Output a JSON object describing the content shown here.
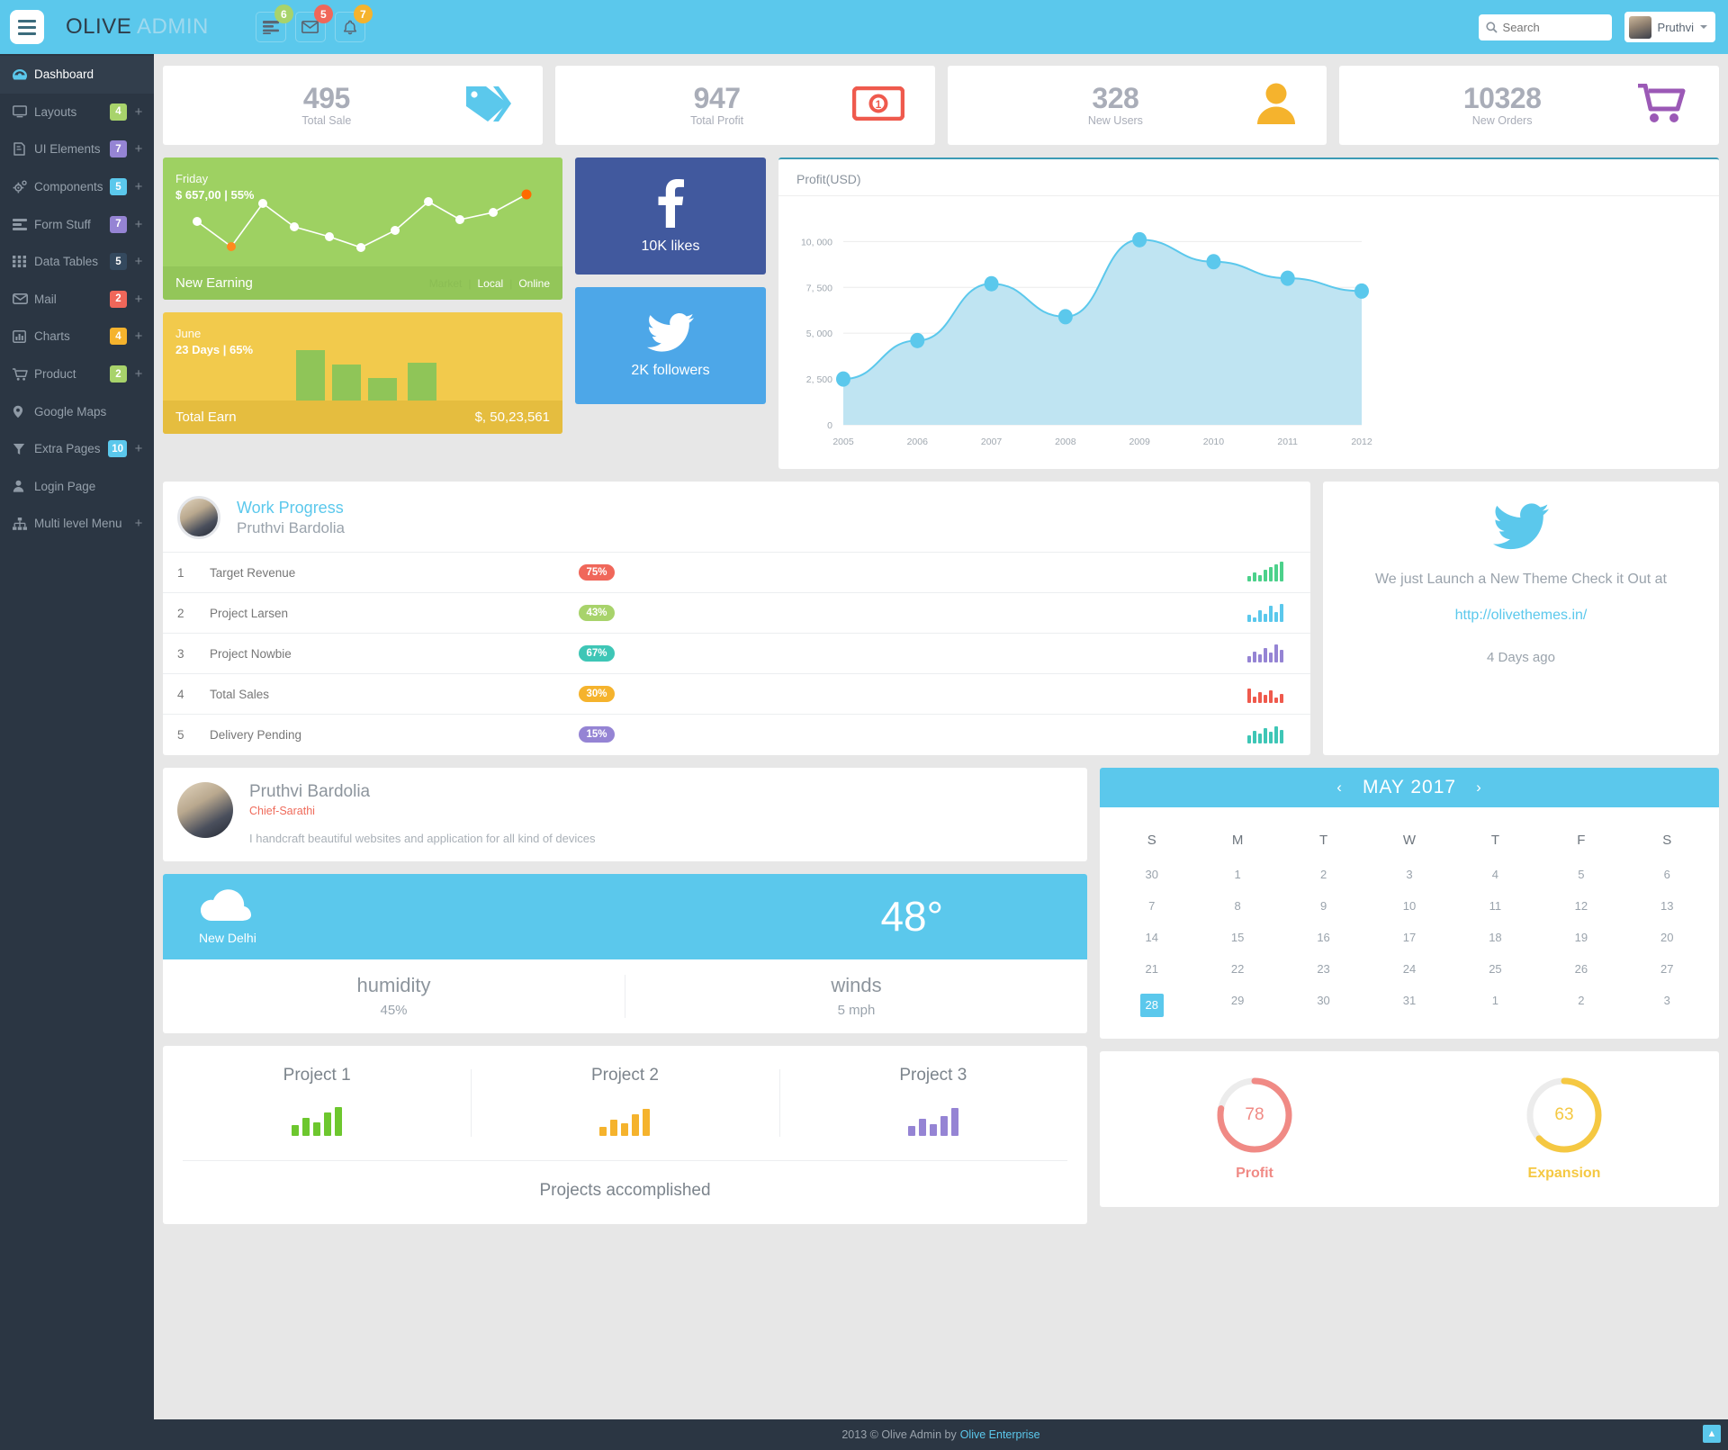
{
  "topbar": {
    "brand_bold": "OLIVE",
    "brand_light": "ADMIN",
    "icons": [
      {
        "name": "list-icon",
        "badge": "6",
        "badge_color": "#a8d36b"
      },
      {
        "name": "mail-icon",
        "badge": "5",
        "badge_color": "#f0675a"
      },
      {
        "name": "bell-icon",
        "badge": "7",
        "badge_color": "#f5b32d"
      }
    ],
    "search_placeholder": "Search",
    "user_name": "Pruthvi"
  },
  "sidebar": {
    "items": [
      {
        "label": "Dashboard",
        "icon": "dashboard-icon",
        "badge": null,
        "badge_color": null,
        "plus": false,
        "active": true
      },
      {
        "label": "Layouts",
        "icon": "monitor-icon",
        "badge": "4",
        "badge_color": "#a8d36b",
        "plus": true,
        "active": false
      },
      {
        "label": "UI Elements",
        "icon": "book-icon",
        "badge": "7",
        "badge_color": "#9584d4",
        "plus": true,
        "active": false
      },
      {
        "label": "Components",
        "icon": "gears-icon",
        "badge": "5",
        "badge_color": "#5bc8ec",
        "plus": true,
        "active": false
      },
      {
        "label": "Form Stuff",
        "icon": "form-icon",
        "badge": "7",
        "badge_color": "#9584d4",
        "plus": true,
        "active": false
      },
      {
        "label": "Data Tables",
        "icon": "grid-icon",
        "badge": "5",
        "badge_color": "#34495e",
        "plus": true,
        "active": false
      },
      {
        "label": "Mail",
        "icon": "envelope-icon",
        "badge": "2",
        "badge_color": "#f0675a",
        "plus": true,
        "active": false
      },
      {
        "label": "Charts",
        "icon": "bar-chart-icon",
        "badge": "4",
        "badge_color": "#f5b32d",
        "plus": true,
        "active": false
      },
      {
        "label": "Product",
        "icon": "cart-icon",
        "badge": "2",
        "badge_color": "#a8d36b",
        "plus": true,
        "active": false
      },
      {
        "label": "Google Maps",
        "icon": "map-pin-icon",
        "badge": null,
        "badge_color": null,
        "plus": false,
        "active": false
      },
      {
        "label": "Extra Pages",
        "icon": "filter-icon",
        "badge": "10",
        "badge_color": "#5bc8ec",
        "plus": true,
        "active": false
      },
      {
        "label": "Login Page",
        "icon": "user-icon",
        "badge": null,
        "badge_color": null,
        "plus": false,
        "active": false
      },
      {
        "label": "Multi level Menu",
        "icon": "sitemap-icon",
        "badge": null,
        "badge_color": null,
        "plus": true,
        "active": false
      }
    ]
  },
  "stats": [
    {
      "value": "495",
      "label": "Total Sale",
      "icon": "tag-icon",
      "color": "#5bc8ec"
    },
    {
      "value": "947",
      "label": "Total Profit",
      "icon": "money-icon",
      "color": "#ef5a4d"
    },
    {
      "value": "328",
      "label": "New Users",
      "icon": "user-icon",
      "color": "#f5b32d"
    },
    {
      "value": "10328",
      "label": "New Orders",
      "icon": "cart-icon",
      "color": "#9b59b6"
    }
  ],
  "earning": {
    "day": "Friday",
    "amount": "$ 657,00 | 55%",
    "footer_title": "New Earning",
    "links": [
      "Market",
      "Local",
      "Online"
    ],
    "month": "June",
    "days": "23 Days | 65%",
    "total_title": "Total Earn",
    "total_value": "$, 50,23,561"
  },
  "social": {
    "facebook": {
      "icon": "facebook-icon",
      "label": "10K likes",
      "color": "#41599e"
    },
    "twitter": {
      "icon": "twitter-icon",
      "label": "2K followers",
      "color": "#4da7e8"
    }
  },
  "chart_data": {
    "type": "area",
    "title": "Profit(USD)",
    "xlabel": "",
    "ylabel": "",
    "x": [
      "2005",
      "2006",
      "2007",
      "2008",
      "2009",
      "2010",
      "2011",
      "2012"
    ],
    "values": [
      2500,
      4600,
      7700,
      5900,
      10100,
      8900,
      8000,
      7300
    ],
    "ylim": [
      0,
      11000
    ],
    "yticks": [
      "0",
      "2, 500",
      "5, 000",
      "7, 500",
      "10, 000"
    ],
    "grid": true,
    "legend": "none",
    "series_color": "#5bc8ec",
    "fill_color": "#bfe4f2"
  },
  "work_progress": {
    "title": "Work Progress",
    "subtitle": "Pruthvi Bardolia",
    "rows": [
      {
        "n": "1",
        "name": "Target Revenue",
        "pct": "75%",
        "color": "#f0675a",
        "spark": [
          6,
          10,
          7,
          13,
          16,
          19,
          22
        ],
        "spark_color": "#4cd18b"
      },
      {
        "n": "2",
        "name": "Project Larsen",
        "pct": "43%",
        "color": "#a8d36b",
        "spark": [
          8,
          5,
          13,
          9,
          18,
          11,
          20
        ],
        "spark_color": "#5bc8ec"
      },
      {
        "n": "3",
        "name": "Project Nowbie",
        "pct": "67%",
        "color": "#3ec6b6",
        "spark": [
          7,
          12,
          9,
          16,
          11,
          20,
          14
        ],
        "spark_color": "#9584d4"
      },
      {
        "n": "4",
        "name": "Total Sales",
        "pct": "30%",
        "color": "#f5b32d",
        "spark": [
          16,
          7,
          12,
          9,
          14,
          6,
          10
        ],
        "spark_color": "#ef5a4d"
      },
      {
        "n": "5",
        "name": "Delivery Pending",
        "pct": "15%",
        "color": "#9584d4",
        "spark": [
          9,
          14,
          11,
          17,
          13,
          19,
          15
        ],
        "spark_color": "#3ec6b6"
      }
    ]
  },
  "tweet": {
    "icon": "twitter-icon",
    "text": "We just Launch a New Theme Check it Out at",
    "link": "http://olivethemes.in/",
    "time": "4 Days ago"
  },
  "profile": {
    "name": "Pruthvi Bardolia",
    "role": "Chief-Sarathi",
    "description": "I handcraft beautiful websites and application for all kind of devices"
  },
  "weather": {
    "icon": "cloud-icon",
    "city": "New Delhi",
    "temp": "48°",
    "humidity_label": "humidity",
    "humidity_value": "45%",
    "winds_label": "winds",
    "winds_value": "5 mph"
  },
  "projects": {
    "items": [
      {
        "title": "Project 1",
        "bars": [
          12,
          20,
          15,
          26,
          32
        ],
        "color": "#6dc72e"
      },
      {
        "title": "Project 2",
        "bars": [
          10,
          18,
          14,
          24,
          30
        ],
        "color": "#f5b32d"
      },
      {
        "title": "Project 3",
        "bars": [
          11,
          19,
          13,
          22,
          31
        ],
        "color": "#9584d4"
      }
    ],
    "footer": "Projects accomplished"
  },
  "calendar": {
    "title": "MAY 2017",
    "prev": "‹",
    "next": "›",
    "dow": [
      "S",
      "M",
      "T",
      "W",
      "T",
      "F",
      "S"
    ],
    "weeks": [
      [
        "30",
        "1",
        "2",
        "3",
        "4",
        "5",
        "6"
      ],
      [
        "7",
        "8",
        "9",
        "10",
        "11",
        "12",
        "13"
      ],
      [
        "14",
        "15",
        "16",
        "17",
        "18",
        "19",
        "20"
      ],
      [
        "21",
        "22",
        "23",
        "24",
        "25",
        "26",
        "27"
      ],
      [
        "28",
        "29",
        "30",
        "31",
        "1",
        "2",
        "3"
      ]
    ],
    "selected": "28"
  },
  "donuts": [
    {
      "value": "78",
      "label": "Profit",
      "color": "#f08a85",
      "track": "#ececec"
    },
    {
      "value": "63",
      "label": "Expansion",
      "color": "#f5c842",
      "track": "#ececec"
    }
  ],
  "footer": {
    "text": "2013 © Olive Admin by",
    "link": "Olive Enterprise",
    "totop": "▲"
  }
}
